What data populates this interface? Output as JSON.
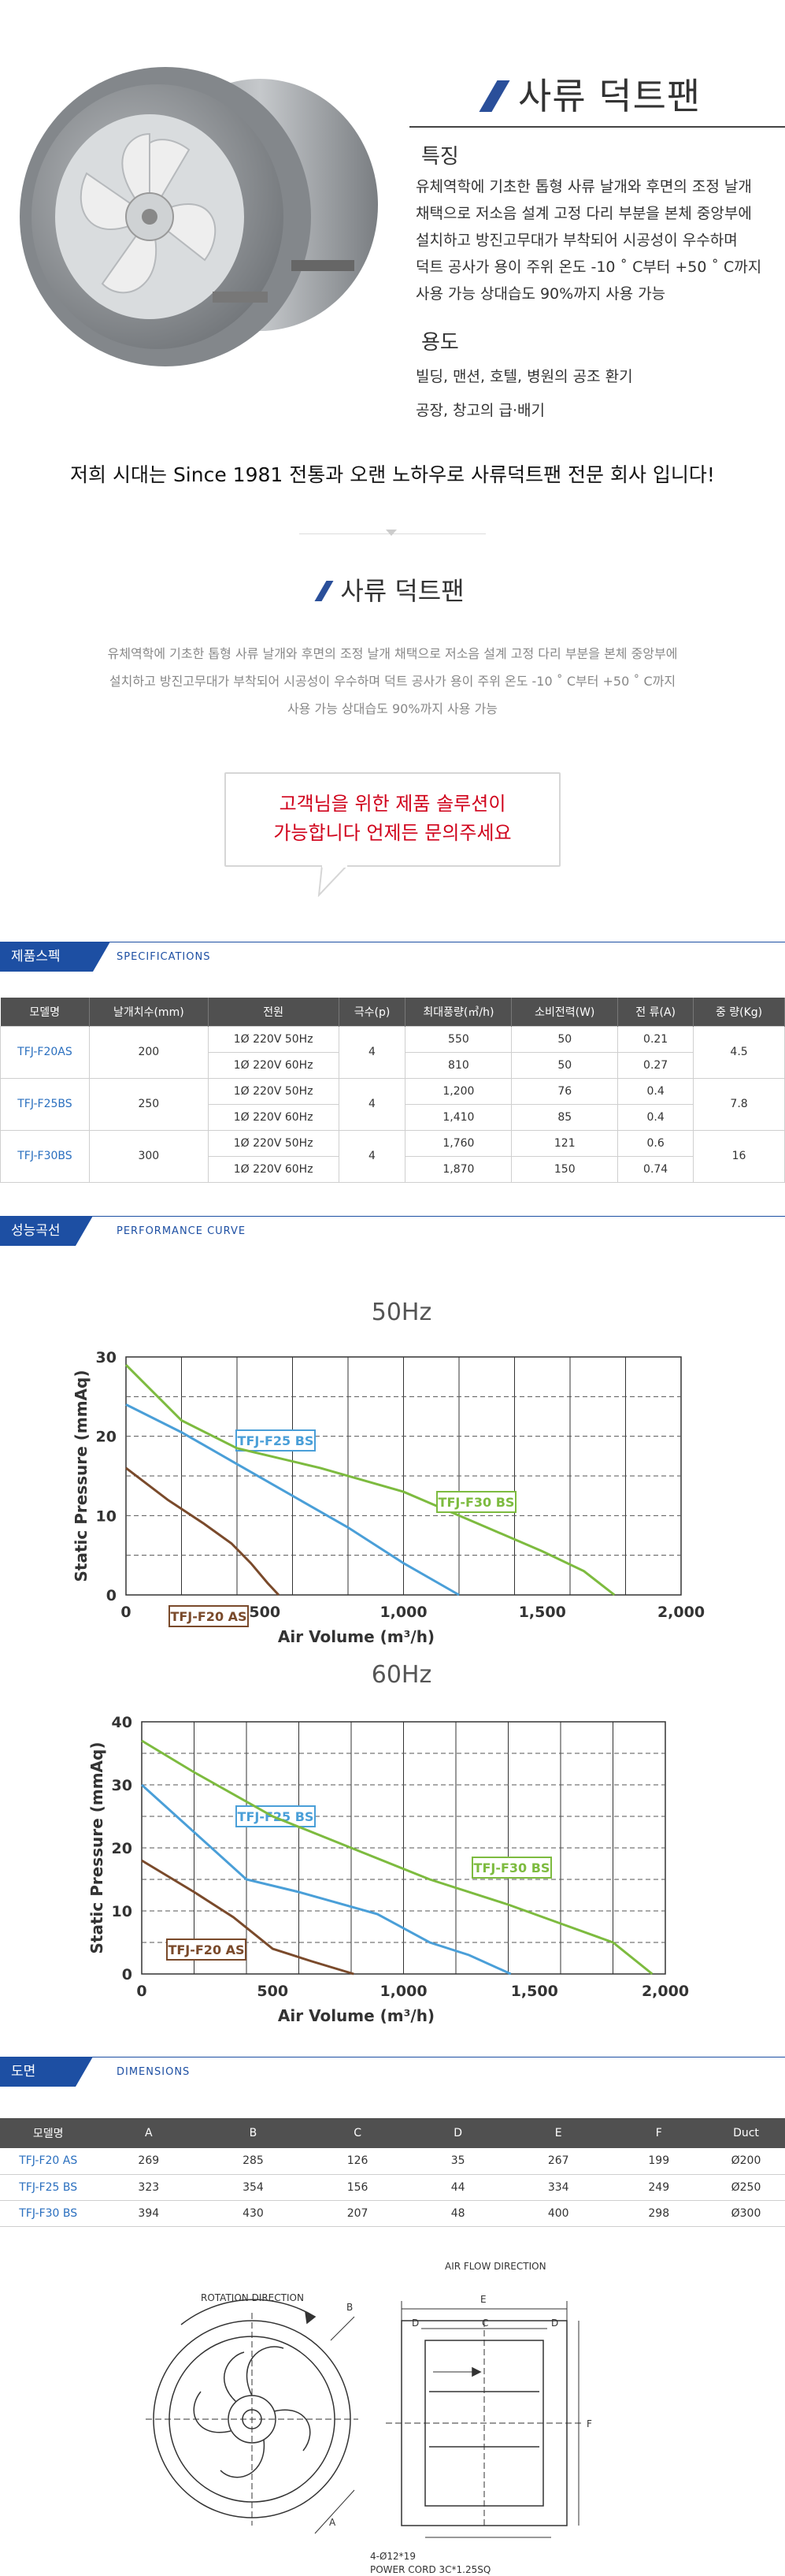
{
  "product": {
    "title": "사류 덕트팬",
    "feature_heading": "특징",
    "feature_lines": [
      "유체역학에 기초한 톱형 사류 날개와 후면의 조정 날개",
      "채택으로 저소음 설계 고정 다리 부분을 본체 중앙부에",
      "설치하고 방진고무대가 부착되어 시공성이 우수하며",
      "덕트 공사가 용이 주위 온도 -10 ˚ C부터 +50 ˚ C까지",
      "사용 가능 상대습도 90%까지 사용 가능"
    ],
    "use_heading": "용도",
    "use_lines": [
      "빌딩, 맨션, 호텔, 병원의 공조 환기",
      "공장, 창고의 급·배기"
    ],
    "slogan": "저희 시대는  Since 1981 전통과 오랜 노하우로  사류덕트팬 전문 회사 입니다!"
  },
  "section2": {
    "title": "사류 덕트팬",
    "desc_lines": [
      "유체역학에 기초한 톱형 사류 날개와 후면의 조정 날개  채택으로 저소음 설계 고정 다리 부분을 본체 중앙부에",
      "설치하고 방진고무대가 부착되어 시공성이 우수하며  덕트 공사가 용이 주위 온도 -10 ˚ C부터 +50 ˚ C까지",
      "사용 가능 상대습도 90%까지 사용 가능"
    ],
    "bubble_lines": [
      "고객님을 위한 제품 솔루션이",
      "가능합니다 언제든 문의주세요"
    ]
  },
  "spec_section": {
    "tag": "제품스펙",
    "tag_en": "SPECIFICATIONS",
    "headers": [
      "모델명",
      "날개치수(mm)",
      "전원",
      "극수(p)",
      "최대풍량(㎥/h)",
      "소비전력(W)",
      "전 류(A)",
      "중 량(Kg)"
    ],
    "models": [
      {
        "model": "TFJ-F20AS",
        "blade": "200",
        "poles": "4",
        "weight": "4.5",
        "rows": [
          {
            "power": "1Ø 220V 50Hz",
            "airflow": "550",
            "watt": "50",
            "amp": "0.21"
          },
          {
            "power": "1Ø 220V 60Hz",
            "airflow": "810",
            "watt": "50",
            "amp": "0.27"
          }
        ]
      },
      {
        "model": "TFJ-F25BS",
        "blade": "250",
        "poles": "4",
        "weight": "7.8",
        "rows": [
          {
            "power": "1Ø 220V 50Hz",
            "airflow": "1,200",
            "watt": "76",
            "amp": "0.4"
          },
          {
            "power": "1Ø 220V 60Hz",
            "airflow": "1,410",
            "watt": "85",
            "amp": "0.4"
          }
        ]
      },
      {
        "model": "TFJ-F30BS",
        "blade": "300",
        "poles": "4",
        "weight": "16",
        "rows": [
          {
            "power": "1Ø 220V 50Hz",
            "airflow": "1,760",
            "watt": "121",
            "amp": "0.6"
          },
          {
            "power": "1Ø 220V 60Hz",
            "airflow": "1,870",
            "watt": "150",
            "amp": "0.74"
          }
        ]
      }
    ]
  },
  "curve_section": {
    "tag": "성능곡선",
    "tag_en": "PERFORMANCE CURVE"
  },
  "chart_data": [
    {
      "type": "line",
      "title": "50Hz",
      "xlabel": "Air Volume (m³/h)",
      "ylabel": "Static Pressure (mmAq)",
      "xlim": [
        0,
        2000
      ],
      "ylim": [
        0,
        30
      ],
      "xticks": [
        "0",
        "500",
        "1,000",
        "1,500",
        "2,000"
      ],
      "yticks": [
        "0",
        "10",
        "20",
        "30"
      ],
      "grid": true,
      "series": [
        {
          "name": "TFJ-F20 AS",
          "color": "#7a4a2b",
          "x": [
            0,
            150,
            280,
            380,
            450,
            510,
            550
          ],
          "y": [
            16,
            12,
            9,
            6.5,
            4,
            1.5,
            0
          ]
        },
        {
          "name": "TFJ-F25 BS",
          "color": "#4a9fd8",
          "x": [
            0,
            200,
            400,
            600,
            800,
            1000,
            1200
          ],
          "y": [
            24,
            20.5,
            16.5,
            12.5,
            8.5,
            4,
            0
          ]
        },
        {
          "name": "TFJ-F30 BS",
          "color": "#7dbb3f",
          "x": [
            0,
            200,
            400,
            700,
            1000,
            1300,
            1500,
            1650,
            1760
          ],
          "y": [
            29,
            22,
            18.5,
            16,
            13,
            8.5,
            5.5,
            3,
            0
          ]
        }
      ]
    },
    {
      "type": "line",
      "title": "60Hz",
      "xlabel": "Air Volume (m³/h)",
      "ylabel": "Static Pressure (mmAq)",
      "xlim": [
        0,
        2000
      ],
      "ylim": [
        0,
        40
      ],
      "xticks": [
        "0",
        "500",
        "1,000",
        "1,500",
        "2,000"
      ],
      "yticks": [
        "0",
        "10",
        "20",
        "30",
        "40"
      ],
      "grid": true,
      "series": [
        {
          "name": "TFJ-F20 AS",
          "color": "#7a4a2b",
          "x": [
            0,
            200,
            350,
            500,
            650,
            810
          ],
          "y": [
            18,
            13,
            9,
            4,
            2,
            0
          ]
        },
        {
          "name": "TFJ-F25 BS",
          "color": "#4a9fd8",
          "x": [
            0,
            200,
            400,
            600,
            900,
            1100,
            1250,
            1410
          ],
          "y": [
            30,
            22.5,
            15,
            13,
            9.5,
            5,
            3,
            0
          ]
        },
        {
          "name": "TFJ-F30 BS",
          "color": "#7dbb3f",
          "x": [
            0,
            200,
            500,
            800,
            1100,
            1400,
            1600,
            1800,
            1950
          ],
          "y": [
            37,
            32,
            25,
            20,
            15,
            11,
            8,
            5,
            0
          ]
        }
      ]
    }
  ],
  "dims_section": {
    "tag": "도면",
    "tag_en": "DIMENSIONS",
    "headers": [
      "모델명",
      "A",
      "B",
      "C",
      "D",
      "E",
      "F",
      "Duct"
    ],
    "rows": [
      [
        "TFJ-F20 AS",
        "269",
        "285",
        "126",
        "35",
        "267",
        "199",
        "Ø200"
      ],
      [
        "TFJ-F25 BS",
        "323",
        "354",
        "156",
        "44",
        "334",
        "249",
        "Ø250"
      ],
      [
        "TFJ-F30 BS",
        "394",
        "430",
        "207",
        "48",
        "400",
        "298",
        "Ø300"
      ]
    ]
  },
  "drawing": {
    "rotation_label": "ROTATION DIRECTION",
    "airflow_label": "AIR FLOW DIRECTION",
    "bolt_label": "4-Ø12*19",
    "cord_label": "POWER CORD 3C*1.25SQ",
    "dim_letters": [
      "A",
      "B",
      "C",
      "D",
      "E",
      "F"
    ]
  }
}
